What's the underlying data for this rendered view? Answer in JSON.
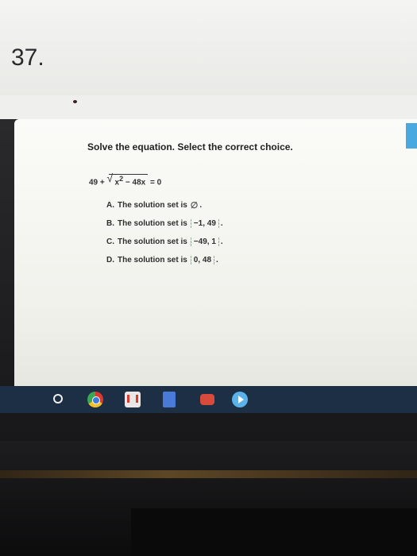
{
  "paper": {
    "problem_number": "37."
  },
  "question": {
    "title": "Solve the equation. Select the correct choice.",
    "equation": {
      "lead": "49 +",
      "radicand_base": "x",
      "radicand_exp": "2",
      "radicand_rest": "− 48x",
      "rhs": "= 0"
    }
  },
  "choices": [
    {
      "letter": "A.",
      "text": "The solution set is",
      "set": "",
      "empty_symbol": "∅",
      "period": "."
    },
    {
      "letter": "B.",
      "text": "The solution set is",
      "set": "−1, 49",
      "period": "."
    },
    {
      "letter": "C.",
      "text": "The solution set is",
      "set": "−49, 1",
      "period": "."
    },
    {
      "letter": "D.",
      "text": "The solution set is",
      "set": "0, 48",
      "period": "."
    }
  ],
  "taskbar": {
    "icons": [
      "launcher-icon",
      "chrome-icon",
      "gmail-icon",
      "docs-icon",
      "youtube-icon",
      "play-store-icon"
    ]
  },
  "colors": {
    "taskbar": "#1d2f44",
    "side_tab": "#4aa8e0"
  }
}
